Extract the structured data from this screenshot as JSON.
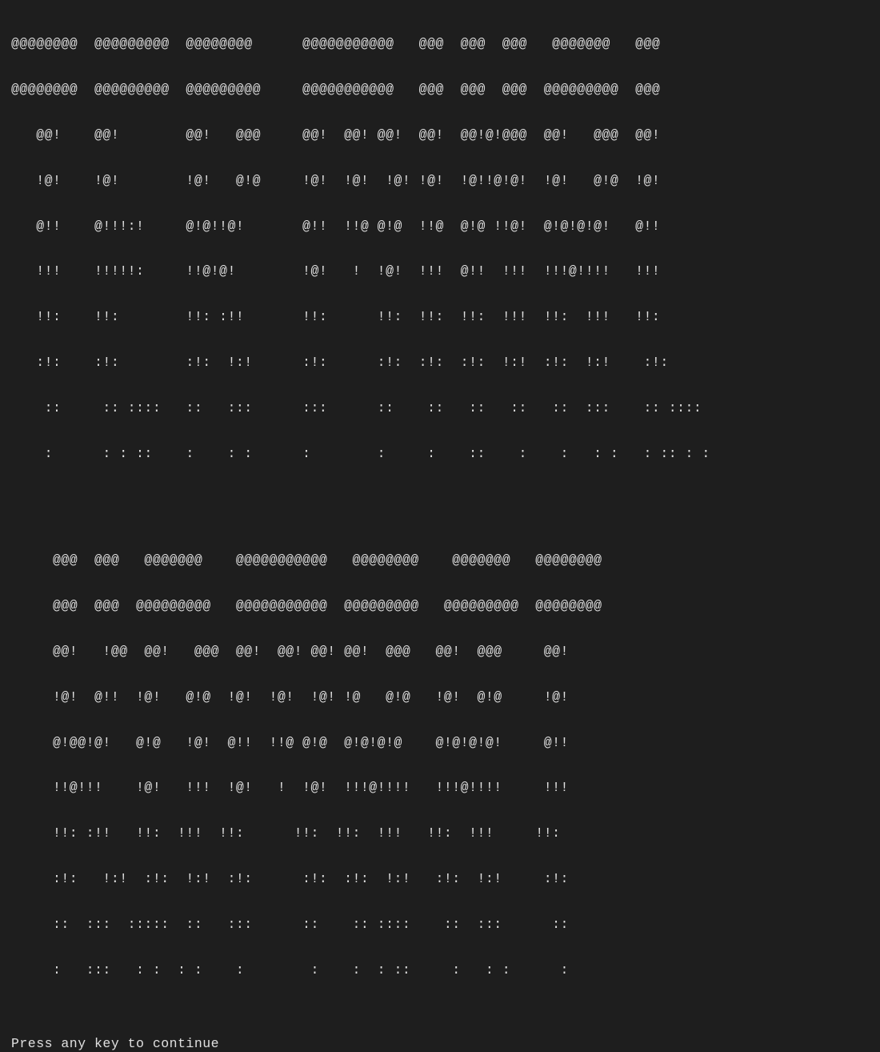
{
  "ascii_art": {
    "line1": [
      "@@@@@@@@  @@@@@@@@@  @@@@@@@@      @@@@@@@@@@@   @@@  @@@  @@@   @@@@@@@   @@@",
      "@@@@@@@@  @@@@@@@@@  @@@@@@@@@     @@@@@@@@@@@   @@@  @@@  @@@  @@@@@@@@@  @@@",
      "   @@!    @@!        @@!   @@@     @@!  @@! @@!  @@!  @@!@!@@@  @@!   @@@  @@!",
      "   !@!    !@!        !@!   @!@     !@!  !@!  !@! !@!  !@!!@!@!  !@!   @!@  !@!",
      "   @!!    @!!!:!     @!@!!@!       @!!  !!@ @!@  !!@  @!@ !!@!  @!@!@!@!   @!!",
      "   !!!    !!!!!:     !!@!@!        !@!   !  !@!  !!!  @!!  !!!  !!!@!!!!   !!!",
      "   !!:    !!:        !!: :!!       !!:      !!:  !!:  !!:  !!!  !!:  !!!   !!:",
      "   :!:    :!:        :!:  !:!      :!:      :!:  :!:  :!:  !:!  :!:  !:!    :!:",
      "    ::     :: ::::   ::   :::      :::      ::    ::   ::   ::   ::  :::    :: ::::",
      "    :      : : ::    :    : :      :        :     :    ::    :    :   : :   : :: : :"
    ],
    "line2": [
      "     @@@  @@@   @@@@@@@    @@@@@@@@@@@   @@@@@@@@    @@@@@@@   @@@@@@@@    ",
      "     @@@  @@@  @@@@@@@@@   @@@@@@@@@@@  @@@@@@@@@   @@@@@@@@@  @@@@@@@@    ",
      "     @@!   !@@  @@!   @@@  @@!  @@! @@! @@!  @@@   @@!  @@@     @@!        ",
      "     !@!  @!!  !@!   @!@  !@!  !@!  !@! !@   @!@   !@!  @!@     !@!        ",
      "     @!@@!@!   @!@   !@!  @!!  !!@ @!@  @!@!@!@    @!@!@!@!     @!!        ",
      "     !!@!!!    !@!   !!!  !@!   !  !@!  !!!@!!!!   !!!@!!!!     !!!        ",
      "     !!: :!!   !!:  !!!  !!:      !!:  !!:  !!!   !!:  !!!     !!:        ",
      "     :!:   !:!  :!:  !:!  :!:      :!:  :!:  !:!   :!:  !:!     :!:        ",
      "     ::  :::  :::::  ::   :::      ::    :: ::::    ::  :::      ::        ",
      "     :   :::   : :  : :    :        :    :  : ::     :   : :      :        "
    ]
  },
  "prompt_text": "Press any key to continue"
}
